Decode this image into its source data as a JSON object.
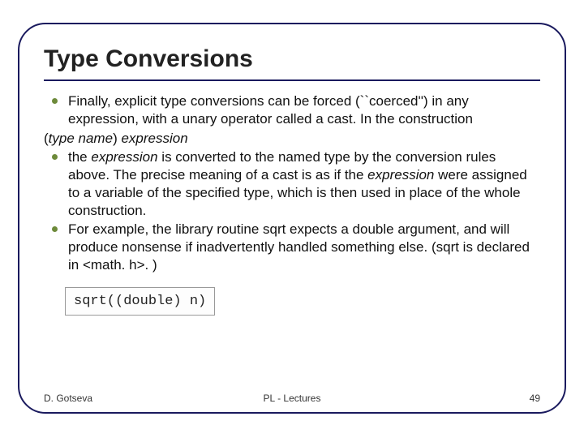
{
  "title": "Type Conversions",
  "bullets": {
    "b1": "Finally, explicit type conversions can be forced (``coerced'') in any expression, with a unary operator called a cast. In the construction",
    "syntax_open": "(",
    "syntax_tn": "type name",
    "syntax_close": ") ",
    "syntax_expr": "expression",
    "b2_pre": "the ",
    "b2_em1": "expression",
    "b2_mid": " is converted to the named type by the conversion rules above. The precise meaning of a cast is as if the ",
    "b2_em2": "expression",
    "b2_post": " were assigned to a variable of the specified type, which is then used in place of the whole construction.",
    "b3": "For example, the library routine sqrt expects a double argument, and will produce nonsense if inadvertently handled something else. (sqrt is declared in <math. h>. )"
  },
  "code": "sqrt((double) n)",
  "footer": {
    "author": "D. Gotseva",
    "center": "PL - Lectures",
    "page": "49"
  }
}
